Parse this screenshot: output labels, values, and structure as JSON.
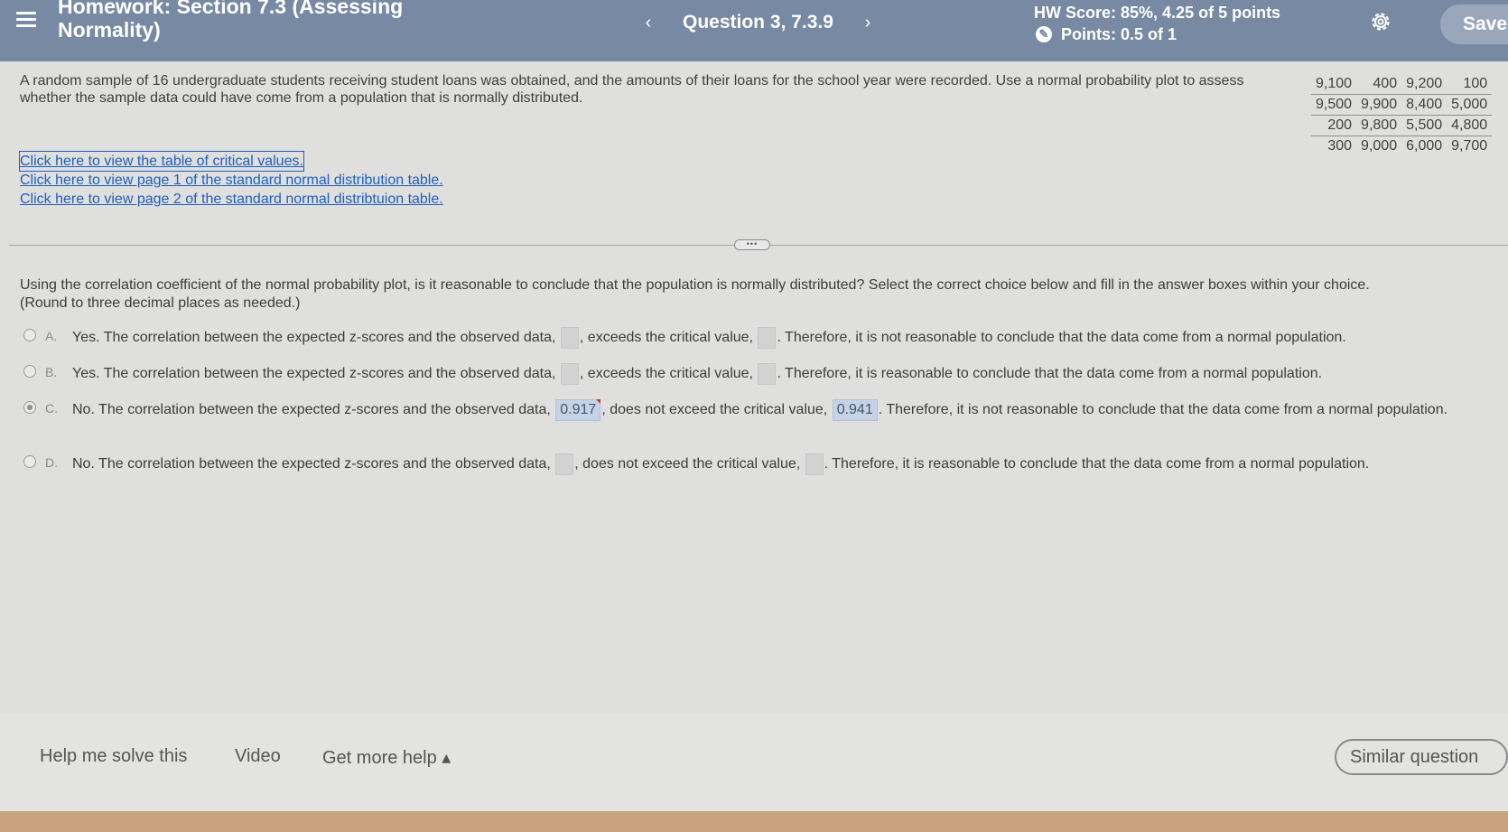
{
  "header": {
    "title": "Homework: Section 7.3 (Assessing Normality)",
    "question_label": "Question 3, 7.3.9",
    "prev_arrow": "‹",
    "next_arrow": "›",
    "hw_score": "HW Score: 85%, 4.25 of 5 points",
    "points": "Points: 0.5 of 1",
    "save_label": "Save"
  },
  "problem": {
    "text": "A random sample of 16 undergraduate students receiving student loans was obtained, and the amounts of their loans for the school year were recorded. Use a normal probability plot to assess whether the sample data could have come from a population that is normally distributed.",
    "table": [
      [
        "9,100",
        "400",
        "9,200",
        "100"
      ],
      [
        "9,500",
        "9,900",
        "8,400",
        "5,000"
      ],
      [
        "200",
        "9,800",
        "5,500",
        "4,800"
      ],
      [
        "300",
        "9,000",
        "6,000",
        "9,700"
      ]
    ],
    "links": [
      "Click here to view the table of critical values.",
      "Click here to view page 1 of the standard normal distribution table.",
      "Click here to view page 2 of the standard normal distribtuion table."
    ]
  },
  "question": {
    "prompt": "Using the correlation coefficient of the normal probability plot, is it reasonable to conclude that the population is normally distributed? Select the correct choice below and fill in the answer boxes within your choice.",
    "round_note": "(Round to three decimal places as needed.)",
    "choices": [
      {
        "letter": "A.",
        "part1": "Yes. The correlation between the expected z-scores and the observed data,",
        "part2": ", exceeds the critical value,",
        "part3": ". Therefore, it is not reasonable to conclude that the data come from a normal population."
      },
      {
        "letter": "B.",
        "part1": "Yes. The correlation between the expected z-scores and the observed data,",
        "part2": ", exceeds the critical value,",
        "part3": ". Therefore, it is reasonable to conclude that the data come from a normal population."
      },
      {
        "letter": "C.",
        "part1": "No. The correlation between the expected z-scores and the observed data,",
        "value1": "0.917",
        "part2": ", does not exceed the critical value,",
        "value2": "0.941",
        "part3": ". Therefore, it is not reasonable to conclude that the data come from a normal population."
      },
      {
        "letter": "D.",
        "part1": "No. The correlation between the expected z-scores and the observed data,",
        "part2": ", does not exceed the critical value,",
        "part3": ". Therefore, it is reasonable to conclude that the data come from a normal population."
      }
    ],
    "selected": "C"
  },
  "footer": {
    "help_label": "Help me solve this",
    "video_label": "Video",
    "more_help_label": "Get more help ▴",
    "similar_label": "Similar question"
  },
  "colors": {
    "header_bg": "#7789a3",
    "link": "#1f5fbf",
    "answer_box": "#c6d3e6"
  }
}
